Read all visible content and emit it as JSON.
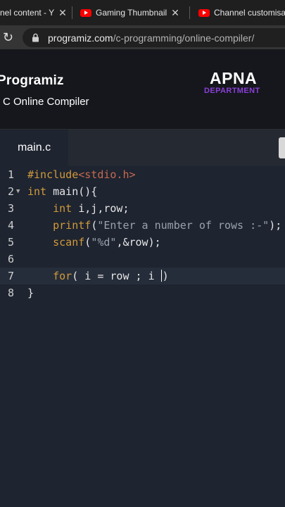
{
  "browser": {
    "tabs": [
      {
        "label": "nel content - Y",
        "has_youtube_icon": false
      },
      {
        "label": "Gaming Thumbnail",
        "has_youtube_icon": true
      },
      {
        "label": "Channel customisati",
        "has_youtube_icon": true
      }
    ],
    "url_host": "programiz.com",
    "url_path": "/c-programming/online-compiler/"
  },
  "site": {
    "brand": "Programiz",
    "subtitle": "C Online Compiler",
    "logo_line1": "APNA",
    "logo_line2": "DEPARTMENT",
    "logo_line2_color": "#8a3fd8"
  },
  "editor": {
    "filename": "main.c",
    "lines": [
      {
        "num": "1",
        "code": "#include<stdio.h>"
      },
      {
        "num": "2",
        "code": "int main(){"
      },
      {
        "num": "3",
        "code": "    int i,j,row;"
      },
      {
        "num": "4",
        "code": "    printf(\"Enter a number of rows :-\");"
      },
      {
        "num": "5",
        "code": "    scanf(\"%d\",&row);"
      },
      {
        "num": "6",
        "code": ""
      },
      {
        "num": "7",
        "code": "    for( i = row ; i )"
      },
      {
        "num": "8",
        "code": "}"
      }
    ],
    "active_line": 7
  },
  "colors": {
    "keyword": "#d19a3b",
    "string": "#9aa3ad",
    "include_header": "#c76a50",
    "editor_bg": "#1e2430"
  }
}
